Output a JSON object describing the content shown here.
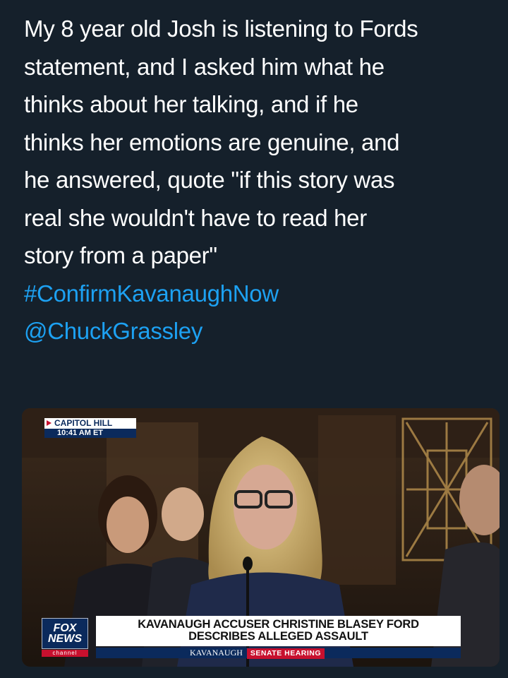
{
  "tweet": {
    "lines": [
      "My 8 year old Josh is listening to Fords",
      "statement, and I asked him what he",
      "thinks about her talking, and if he",
      "thinks her emotions are genuine, and",
      "he answered, quote \"if this story was",
      "real she wouldn't have to read her",
      "story from a paper\""
    ],
    "hashtag": "#ConfirmKavanaughNow",
    "mention": "@ChuckGrassley"
  },
  "video": {
    "location": "CAPITOL HILL",
    "time": "10:41 AM ET",
    "headline_line1": "KAVANAUGH ACCUSER CHRISTINE BLASEY FORD",
    "headline_line2": "DESCRIBES ALLEGED ASSAULT",
    "subtitle": "KAVANAUGH",
    "subtitle_tag": "SENATE HEARING",
    "logo_line1": "FOX",
    "logo_line2": "NEWS",
    "logo_channel": "channel"
  },
  "colors": {
    "background": "#15202b",
    "text": "#ffffff",
    "link": "#1da1f2",
    "fox_blue": "#0b2a5c",
    "fox_red": "#c8102e"
  }
}
